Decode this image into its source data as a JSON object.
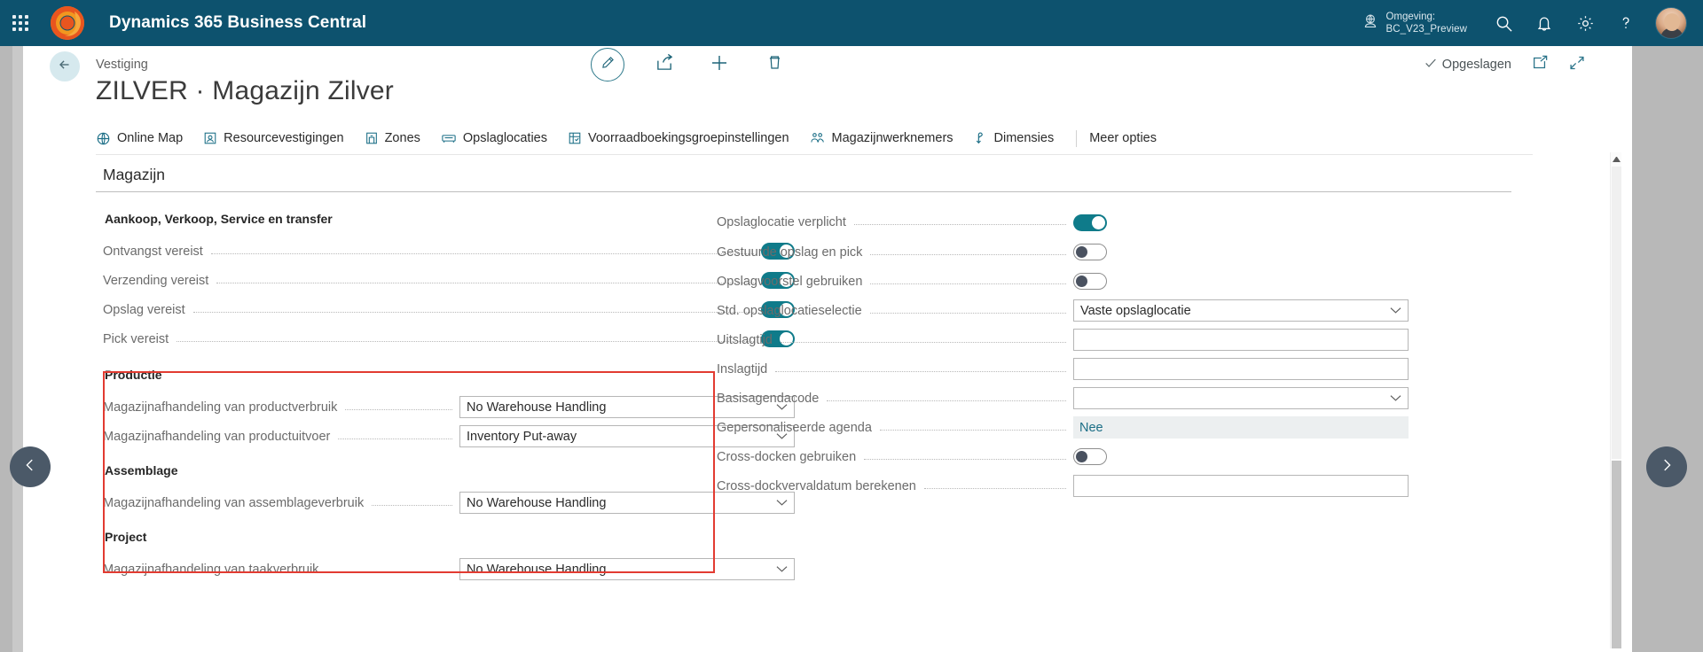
{
  "topbar": {
    "waffle_icon": "app-launcher-icon",
    "logo_icon": "dynamics-logo-icon",
    "app_title": "Dynamics 365 Business Central",
    "environment": {
      "icon": "environment-globe-icon",
      "label": "Omgeving:",
      "value": "BC_V23_Preview"
    },
    "icons": [
      {
        "name": "search-icon",
        "glyph": "search"
      },
      {
        "name": "notifications-bell-icon",
        "glyph": "bell"
      },
      {
        "name": "settings-gear-icon",
        "glyph": "gear"
      },
      {
        "name": "help-question-icon",
        "glyph": "question"
      }
    ],
    "avatar_name": "user-avatar"
  },
  "commandbar": {
    "back_icon": "back-arrow-icon",
    "breadcrumb": "Vestiging",
    "center_actions": [
      {
        "name": "edit-button",
        "icon": "pencil-icon"
      },
      {
        "name": "share-button",
        "icon": "share-icon"
      },
      {
        "name": "new-button",
        "icon": "plus-icon"
      },
      {
        "name": "delete-button",
        "icon": "trash-icon"
      }
    ],
    "saved_label": "Opgeslagen",
    "saved_icon": "checkmark-icon",
    "open-new-window_icon": "open-in-new-window-icon",
    "minimize_icon": "collapse-icon"
  },
  "page": {
    "title": "ZILVER · Magazijn Zilver"
  },
  "actions": [
    {
      "label": "Online Map",
      "icon": "globe-map-icon"
    },
    {
      "label": "Resourcevestigingen",
      "icon": "resource-location-icon"
    },
    {
      "label": "Zones",
      "icon": "zones-icon"
    },
    {
      "label": "Opslaglocaties",
      "icon": "bin-icon"
    },
    {
      "label": "Voorraadboekingsgroepinstellingen",
      "icon": "inventory-posting-setup-icon"
    },
    {
      "label": "Magazijnwerknemers",
      "icon": "warehouse-employees-icon"
    },
    {
      "label": "Dimensies",
      "icon": "dimensions-icon"
    }
  ],
  "actions_more": "Meer opties",
  "section": {
    "title": "Magazijn"
  },
  "left_column": {
    "group1_title": "Aankoop, Verkoop, Service en transfer",
    "group1_rows": [
      {
        "label": "Ontvangst vereist",
        "type": "toggle",
        "value": "on"
      },
      {
        "label": "Verzending vereist",
        "type": "toggle",
        "value": "on"
      },
      {
        "label": "Opslag vereist",
        "type": "toggle",
        "value": "on"
      },
      {
        "label": "Pick vereist",
        "type": "toggle",
        "value": "on"
      }
    ],
    "group2_title": "Productie",
    "group2_rows": [
      {
        "label": "Magazijnafhandeling van productverbruik",
        "type": "dropdown",
        "value": "No Warehouse Handling"
      },
      {
        "label": "Magazijnafhandeling van productuitvoer",
        "type": "dropdown",
        "value": "Inventory Put-away"
      }
    ],
    "group3_title": "Assemblage",
    "group3_rows": [
      {
        "label": "Magazijnafhandeling van assemblageverbruik",
        "type": "dropdown",
        "value": "No Warehouse Handling"
      }
    ],
    "group4_title": "Project",
    "group4_rows": [
      {
        "label": "Magazijnafhandeling van taakverbruik",
        "type": "dropdown",
        "value": "No Warehouse Handling"
      }
    ]
  },
  "right_column": {
    "rows": [
      {
        "label": "Opslaglocatie verplicht",
        "type": "toggle",
        "value": "on"
      },
      {
        "label": "Gestuurde opslag en pick",
        "type": "toggle",
        "value": "off"
      },
      {
        "label": "Opslagvoorstel gebruiken",
        "type": "toggle",
        "value": "off"
      },
      {
        "label": "Std. opslaglocatieselectie",
        "type": "dropdown",
        "value": "Vaste opslaglocatie"
      },
      {
        "label": "Uitslagtijd",
        "type": "text",
        "value": ""
      },
      {
        "label": "Inslagtijd",
        "type": "text",
        "value": ""
      },
      {
        "label": "Basisagendacode",
        "type": "dropdown",
        "value": ""
      },
      {
        "label": "Gepersonaliseerde agenda",
        "type": "flat",
        "value": "Nee"
      },
      {
        "label": "Cross-docken gebruiken",
        "type": "toggle",
        "value": "off"
      },
      {
        "label": "Cross-dockvervaldatum berekenen",
        "type": "text",
        "value": ""
      }
    ]
  },
  "nav": {
    "prev_icon": "chevron-left-icon",
    "next_icon": "chevron-right-icon"
  },
  "colors": {
    "brand_header": "#0d526e",
    "accent_teal": "#0f7b8a",
    "link_teal": "#1b6e86",
    "highlight_red": "#e23b31"
  }
}
